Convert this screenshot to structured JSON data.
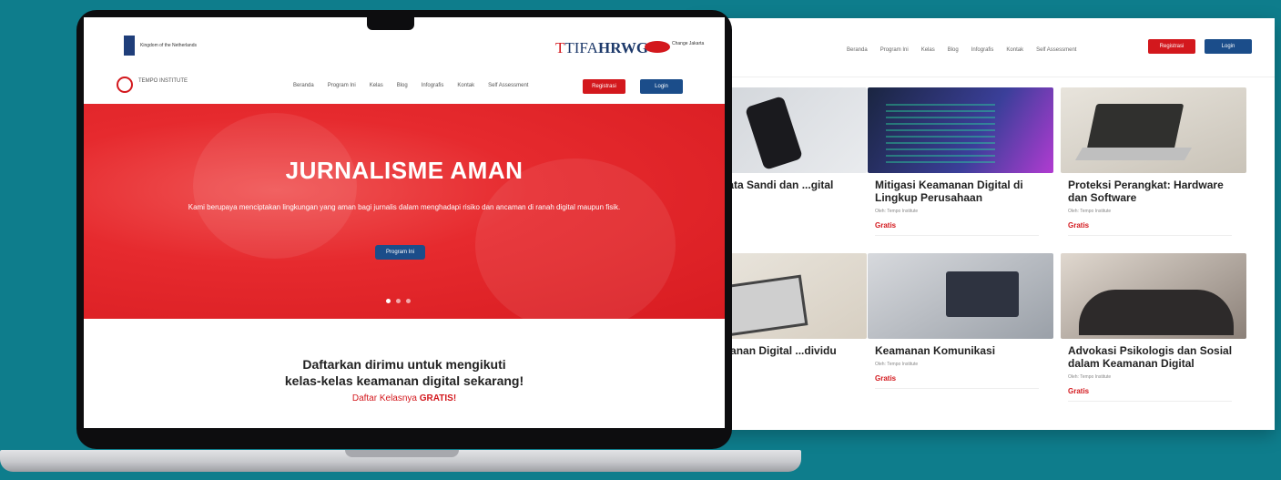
{
  "back_page": {
    "nav": [
      "Beranda",
      "Program Ini",
      "Kelas",
      "Blog",
      "Infografis",
      "Kontak",
      "Self Assessment"
    ],
    "register_label": "Registrasi",
    "login_label": "Login",
    "cards": [
      {
        "title": "...nen Kata Sandi dan ...gital",
        "by": "...",
        "price": ""
      },
      {
        "title": "Mitigasi Keamanan Digital di Lingkup Perusahaan",
        "by": "Oleh: Tempo Institute",
        "price": "Gratis"
      },
      {
        "title": "Proteksi Perangkat: Hardware dan Software",
        "by": "Oleh: Tempo Institute",
        "price": "Gratis"
      },
      {
        "title": "... Keamanan Digital ...dividu",
        "by": "...",
        "price": ""
      },
      {
        "title": "Keamanan Komunikasi",
        "by": "Oleh: Tempo Institute",
        "price": "Gratis"
      },
      {
        "title": "Advokasi Psikologis dan Sosial dalam Keamanan Digital",
        "by": "Oleh: Tempo Institute",
        "price": "Gratis"
      }
    ]
  },
  "front_page": {
    "gov_text": "Kingdom of the Netherlands",
    "tifa": "TIFA",
    "hrwg": "HRWG",
    "partner_text": "Change Jakarta",
    "logo_text": "TEMPO INSTITUTE",
    "nav": [
      "Beranda",
      "Program Ini",
      "Kelas",
      "Blog",
      "Infografis",
      "Kontak",
      "Self Assessment"
    ],
    "register_label": "Registrasi",
    "login_label": "Login",
    "hero_title": "JURNALISME AMAN",
    "hero_text": "Kami berupaya menciptakan lingkungan yang aman bagi jurnalis dalam menghadapi risiko dan ancaman di ranah digital maupun fisik.",
    "hero_button": "Program Ini",
    "signup_line1": "Daftarkan dirimu untuk mengikuti",
    "signup_line2": "kelas-kelas keamanan digital sekarang!",
    "signup_line3_prefix": "Daftar Kelasnya",
    "signup_line3_free": "GRATIS!"
  }
}
